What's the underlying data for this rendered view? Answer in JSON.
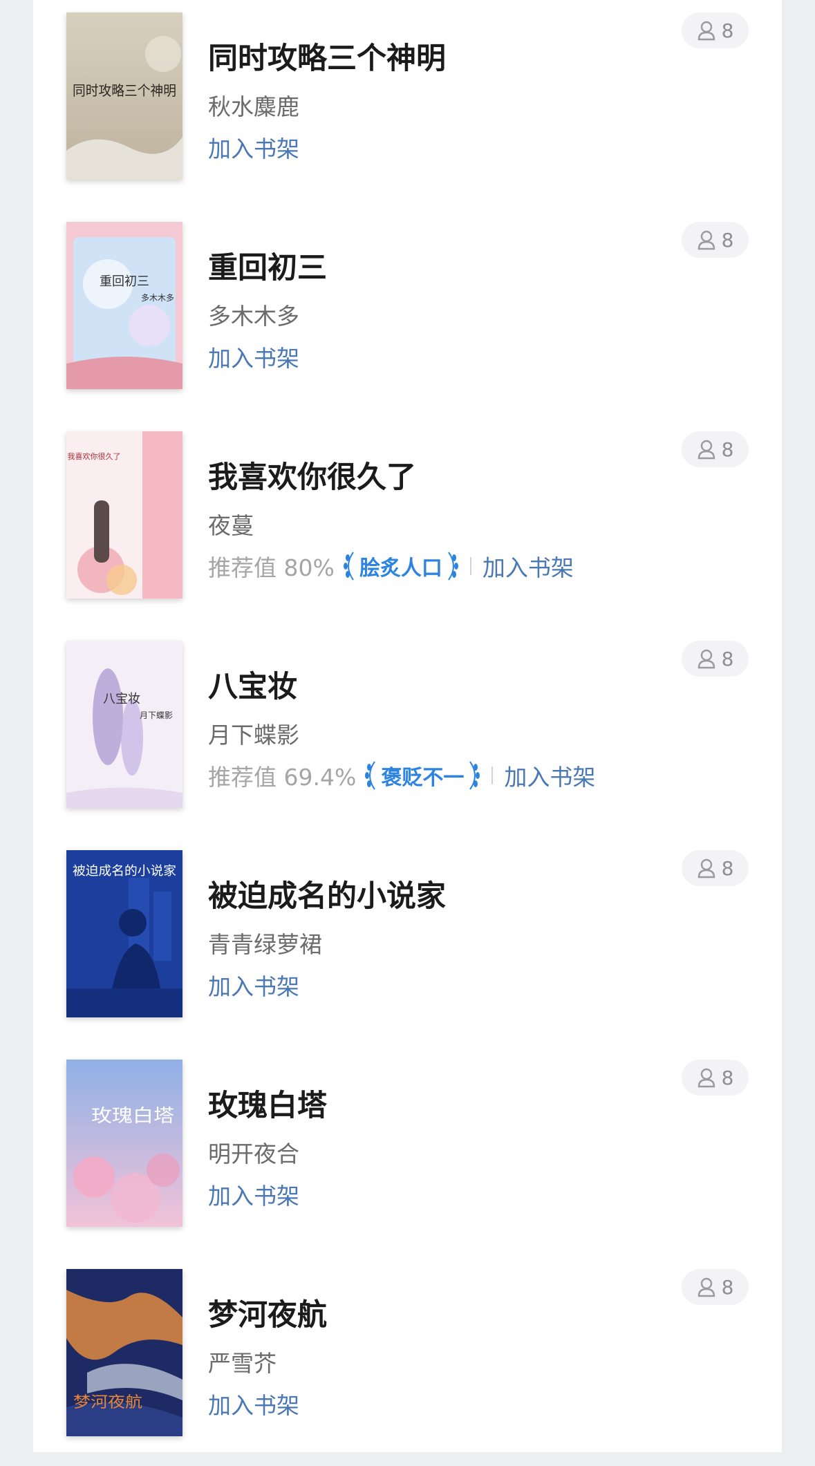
{
  "books": [
    {
      "title": "同时攻略三个神明",
      "author": "秋水麋鹿",
      "readers": "8",
      "shelf_label": "加入书架",
      "cover_text": "同时攻略三个神明"
    },
    {
      "title": "重回初三",
      "author": "多木木多",
      "readers": "8",
      "shelf_label": "加入书架",
      "cover_text": "重回初三",
      "cover_author": "多木木多"
    },
    {
      "title": "我喜欢你很久了",
      "author": "夜蔓",
      "readers": "8",
      "shelf_label": "加入书架",
      "recommend": "推荐值 80%",
      "badge": "脍炙人口",
      "cover_text": "我喜欢你很久了"
    },
    {
      "title": "八宝妆",
      "author": "月下蝶影",
      "readers": "8",
      "shelf_label": "加入书架",
      "recommend": "推荐值 69.4%",
      "badge": "褒贬不一",
      "cover_text": "八宝妆",
      "cover_author": "月下蝶影"
    },
    {
      "title": "被迫成名的小说家",
      "author": "青青绿萝裙",
      "readers": "8",
      "shelf_label": "加入书架",
      "cover_text": "被迫成名的小说家"
    },
    {
      "title": "玫瑰白塔",
      "author": "明开夜合",
      "readers": "8",
      "shelf_label": "加入书架",
      "cover_text": "玫瑰白塔"
    },
    {
      "title": "梦河夜航",
      "author": "严雪芥",
      "readers": "8",
      "shelf_label": "加入书架",
      "cover_text": "梦河夜航"
    }
  ],
  "colors": {
    "background": "#eceef2",
    "title": "#1b1b1b",
    "author": "#6b6b6b",
    "recommend": "#a5a5a5",
    "badge": "#2d84e0",
    "shelf_link": "#4a78b5",
    "reader_pill": "#f3f3f5"
  },
  "icons": {
    "reader_count": "user-icon",
    "badge_decoration": "laurel-icon"
  }
}
